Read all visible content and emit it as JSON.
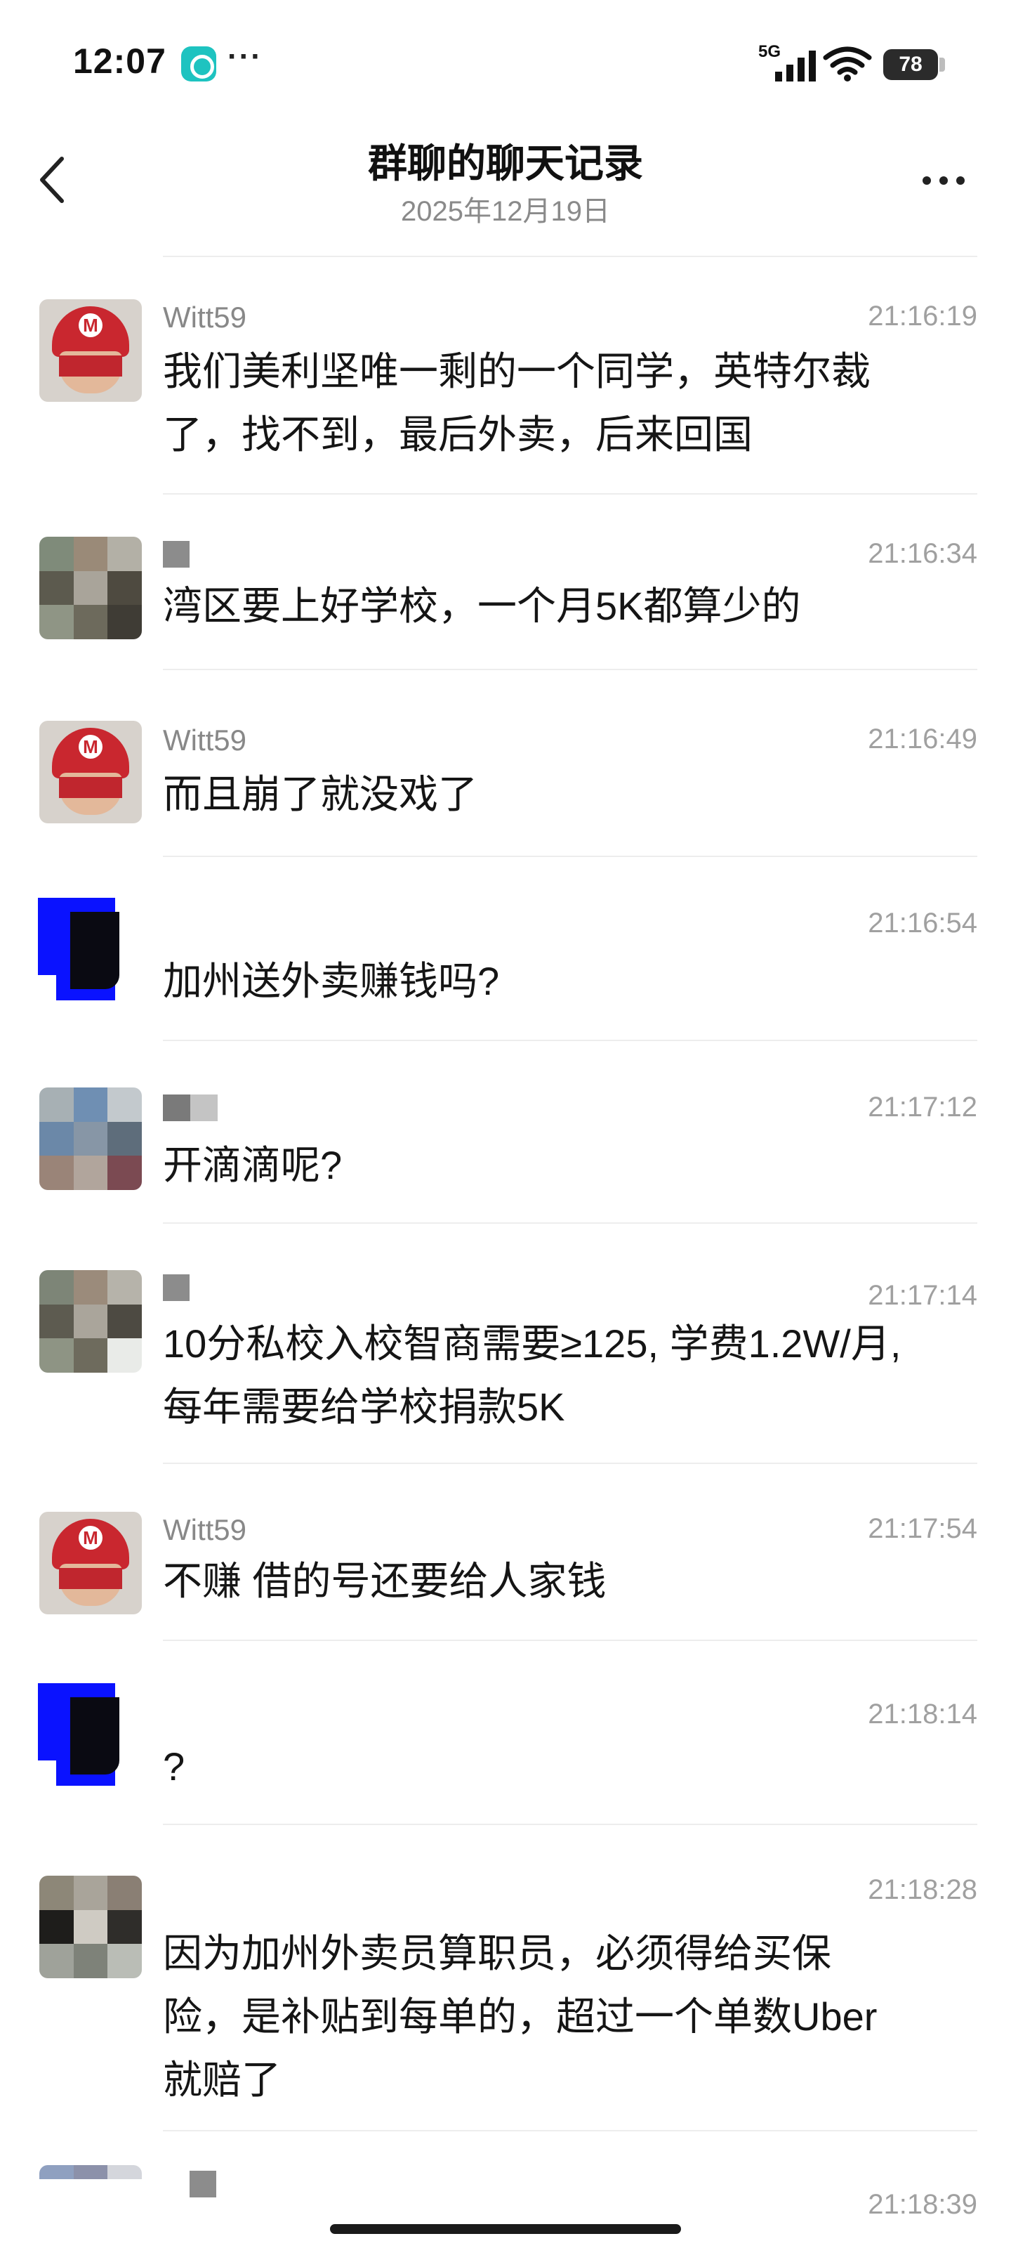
{
  "status_bar": {
    "time": "12:07",
    "dots": "···",
    "network": "5G",
    "battery": "78",
    "app_icon": "app-badge-icon",
    "signal_icon": "signal-icon",
    "wifi_icon": "wifi-icon"
  },
  "header": {
    "title": "群聊的聊天记录",
    "date": "2025年12月19日",
    "back_icon": "back-arrow-icon",
    "more_icon": "more-icon"
  },
  "messages": [
    {
      "sender": "Witt59",
      "time": "21:16:19",
      "text": "我们美利坚唯一剩的一个同学，英特尔裁\n了，找不到，最后外卖，后来回国"
    },
    {
      "sender": "",
      "time": "21:16:34",
      "text": "湾区要上好学校，一个月5K都算少的"
    },
    {
      "sender": "Witt59",
      "time": "21:16:49",
      "text": "而且崩了就没戏了"
    },
    {
      "sender": "",
      "time": "21:16:54",
      "text": "加州送外卖赚钱吗?"
    },
    {
      "sender": "",
      "time": "21:17:12",
      "text": "开滴滴呢?"
    },
    {
      "sender": "",
      "time": "21:17:14",
      "text": "10分私校入校智商需要≥125, 学费1.2W/月,\n每年需要给学校捐款5K"
    },
    {
      "sender": "Witt59",
      "time": "21:17:54",
      "text": "不赚 借的号还要给人家钱"
    },
    {
      "sender": "",
      "time": "21:18:14",
      "text": "?"
    },
    {
      "sender": "",
      "time": "21:18:28",
      "text": "因为加州外卖员算职员，必须得给买保\n险，是补贴到每单的，超过一个单数Uber\n就赔了"
    },
    {
      "sender": "",
      "time": "21:18:39",
      "text": ""
    }
  ]
}
